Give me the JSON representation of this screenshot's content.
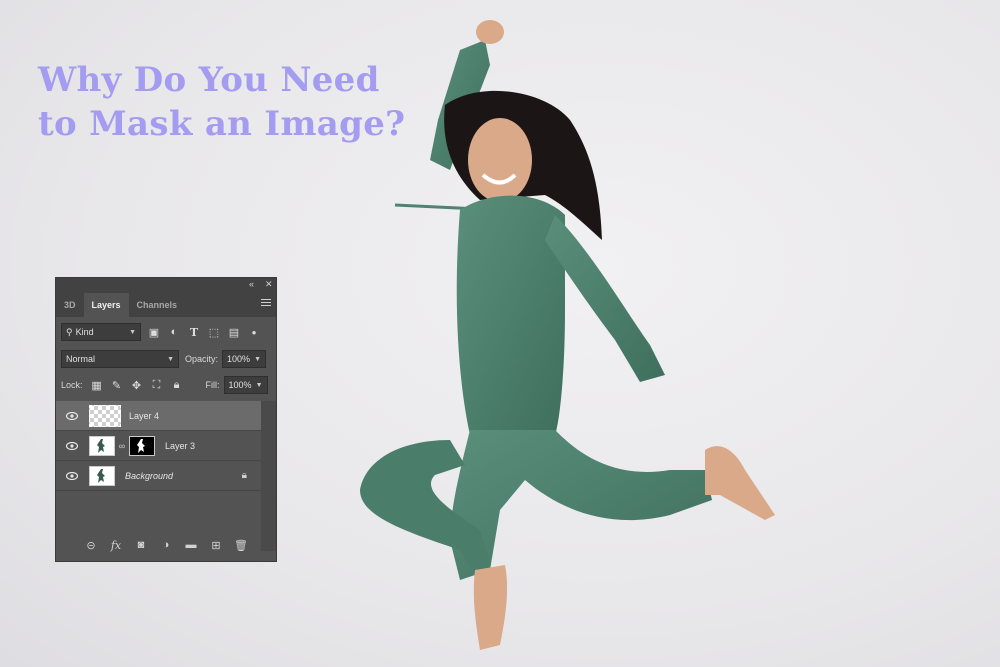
{
  "headline": {
    "line1": "Why Do You Need",
    "line2": "to Mask an Image?",
    "color": "#a49cf0"
  },
  "photo": {
    "suit_color": "#4f8370",
    "skin_color": "#d9a98a",
    "hair_color": "#1b1516"
  },
  "panel": {
    "tabs": [
      "3D",
      "Layers",
      "Channels"
    ],
    "active_tab": "Layers",
    "filter": {
      "label": "Kind"
    },
    "blend_mode": "Normal",
    "opacity_label": "Opacity:",
    "opacity_value": "100%",
    "lock_label": "Lock:",
    "fill_label": "Fill:",
    "fill_value": "100%",
    "layers": [
      {
        "name": "Layer 4",
        "selected": true
      },
      {
        "name": "Layer 3",
        "selected": false
      },
      {
        "name": "Background",
        "selected": false
      }
    ]
  }
}
